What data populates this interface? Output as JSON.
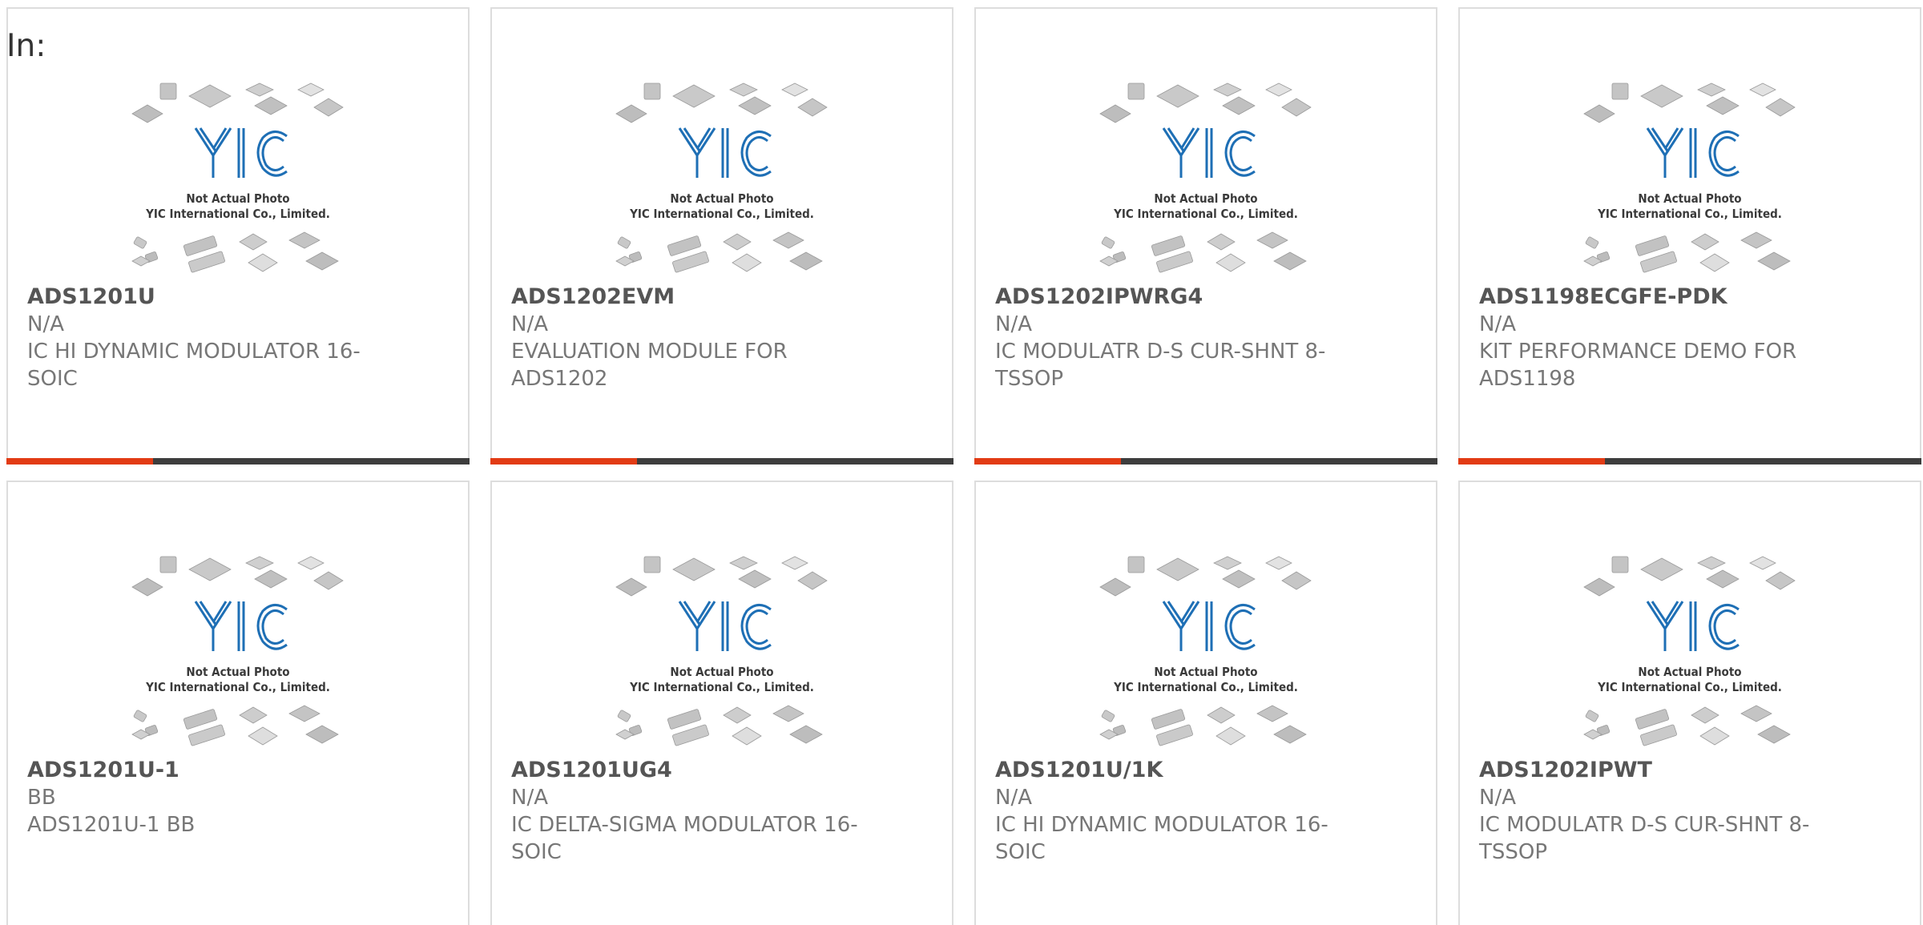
{
  "header": {
    "label": "In:"
  },
  "thumbnail": {
    "caption_line1": "Not Actual Photo",
    "caption_line2": "YIC International Co., Limited.",
    "logo_text": "YIC",
    "logo_color": "#1e6fb5"
  },
  "colors": {
    "accent": "#e23b14",
    "bar": "#3d3d3d",
    "card_border": "#dddddd",
    "text": "#777777",
    "title": "#555555"
  },
  "products": [
    {
      "part": "ADS1201U",
      "mfr": "N/A",
      "desc": "IC HI DYNAMIC MODULATOR 16-SOIC"
    },
    {
      "part": "ADS1202EVM",
      "mfr": "N/A",
      "desc": "EVALUATION MODULE FOR ADS1202"
    },
    {
      "part": "ADS1202IPWRG4",
      "mfr": "N/A",
      "desc": "IC MODULATR D-S CUR-SHNT 8-TSSOP"
    },
    {
      "part": "ADS1198ECGFE-PDK",
      "mfr": "N/A",
      "desc": "KIT PERFORMANCE DEMO FOR ADS1198"
    },
    {
      "part": "ADS1201U-1",
      "mfr": "BB",
      "desc": "ADS1201U-1 BB"
    },
    {
      "part": "ADS1201UG4",
      "mfr": "N/A",
      "desc": "IC DELTA-SIGMA MODULATOR 16-SOIC"
    },
    {
      "part": "ADS1201U/1K",
      "mfr": "N/A",
      "desc": "IC HI DYNAMIC MODULATOR 16-SOIC"
    },
    {
      "part": "ADS1202IPWT",
      "mfr": "N/A",
      "desc": "IC MODULATR D-S CUR-SHNT 8-TSSOP"
    }
  ]
}
